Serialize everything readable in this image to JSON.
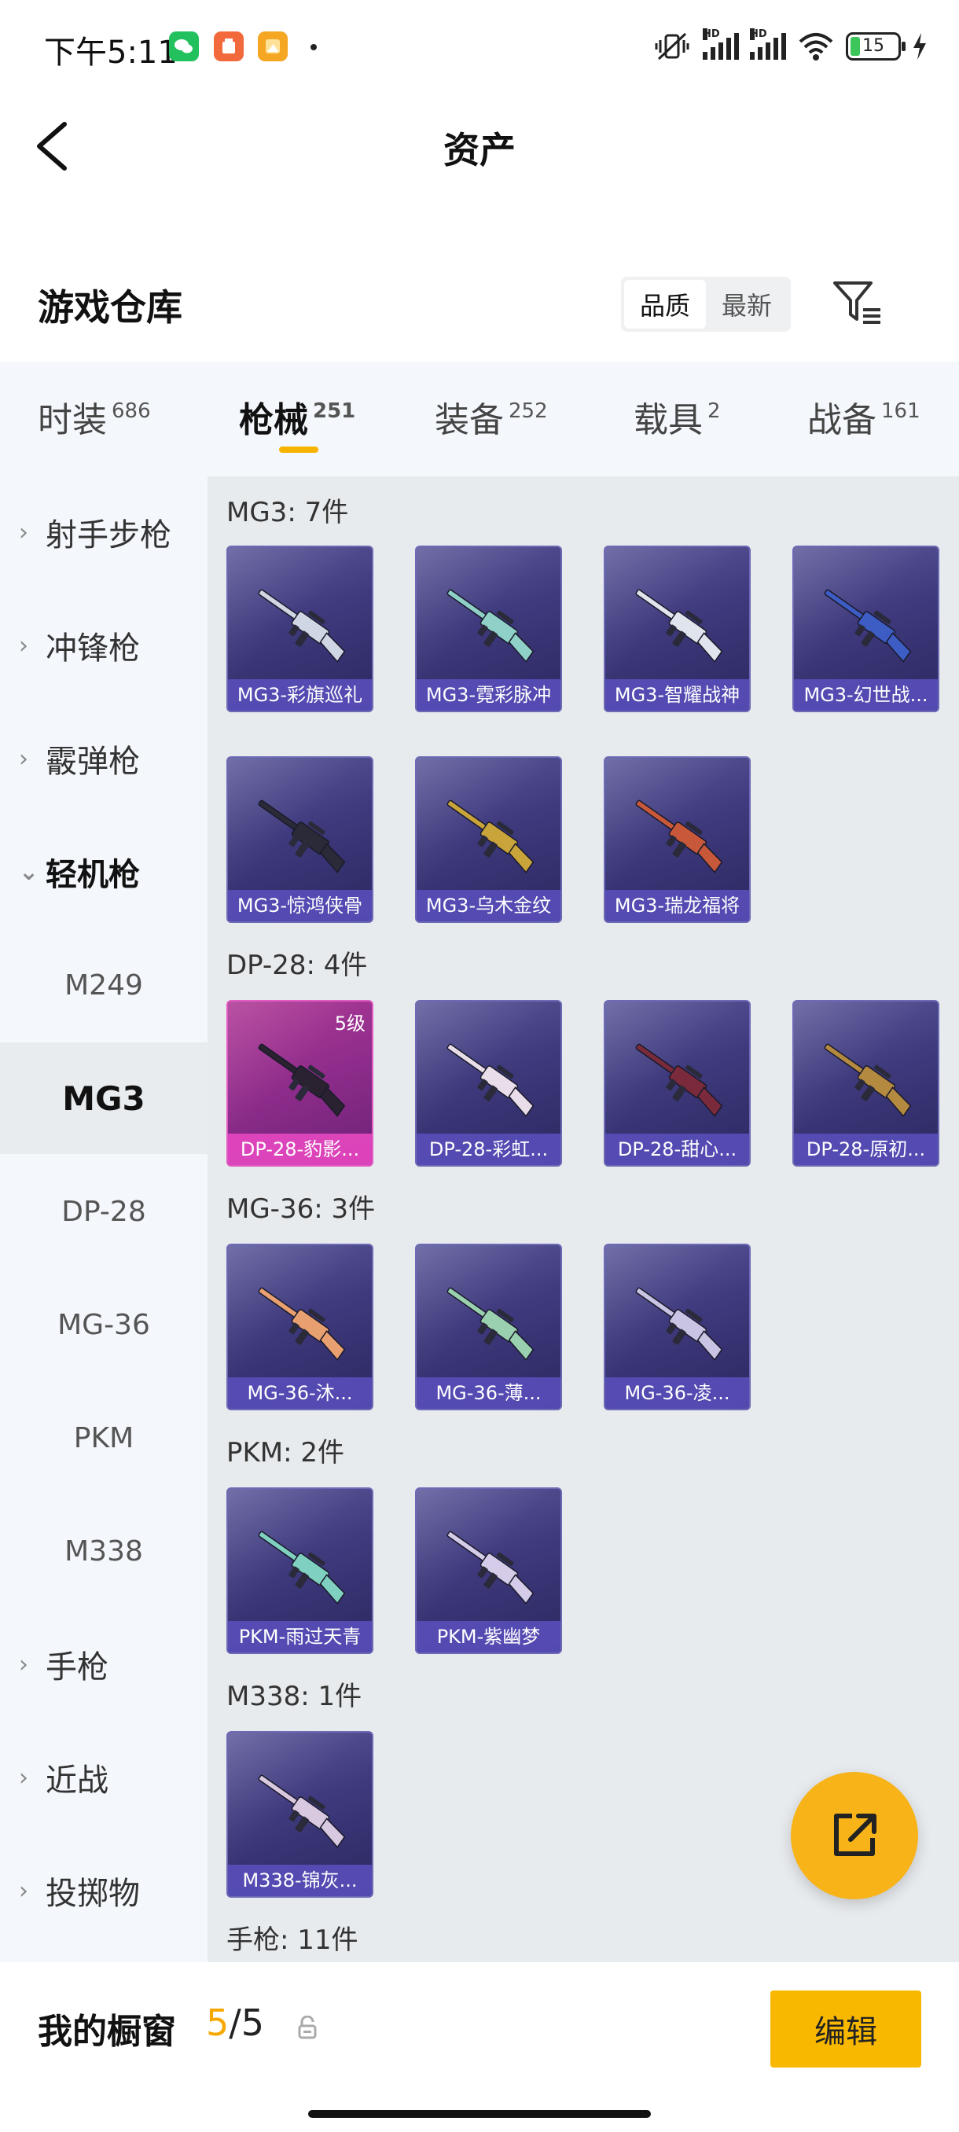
{
  "status_bar": {
    "time": "下午5:11",
    "battery": "15",
    "signal_label_1": "HD",
    "signal_label_2": "HD"
  },
  "header": {
    "title": "资产"
  },
  "warehouse": {
    "title": "游戏仓库",
    "sort_options": [
      "品质",
      "最新"
    ],
    "active_sort": "品质"
  },
  "tabs": [
    {
      "label": "时装",
      "count": "686"
    },
    {
      "label": "枪械",
      "count": "251"
    },
    {
      "label": "装备",
      "count": "252"
    },
    {
      "label": "载具",
      "count": "2"
    },
    {
      "label": "战备",
      "count": "161"
    }
  ],
  "active_tab": "枪械",
  "sidebar": {
    "items": [
      {
        "label": "射手步枪",
        "type": "category"
      },
      {
        "label": "冲锋枪",
        "type": "category"
      },
      {
        "label": "霰弹枪",
        "type": "category"
      },
      {
        "label": "轻机枪",
        "type": "category-open"
      },
      {
        "label": "M249",
        "type": "sub"
      },
      {
        "label": "MG3",
        "type": "sub-active"
      },
      {
        "label": "DP-28",
        "type": "sub"
      },
      {
        "label": "MG-36",
        "type": "sub"
      },
      {
        "label": "PKM",
        "type": "sub"
      },
      {
        "label": "M338",
        "type": "sub"
      },
      {
        "label": "手枪",
        "type": "category"
      },
      {
        "label": "近战",
        "type": "category"
      },
      {
        "label": "投掷物",
        "type": "category"
      }
    ]
  },
  "groups": [
    {
      "title": "MG3: 7件",
      "items": [
        {
          "name": "MG3-彩旗巡礼",
          "color": "#cfd6e4"
        },
        {
          "name": "MG3-霓彩脉冲",
          "color": "#8fd0c8"
        },
        {
          "name": "MG3-智耀战神",
          "color": "#e0e4ec"
        },
        {
          "name": "MG3-幻世战...",
          "color": "#3d5cc4"
        },
        {
          "name": "MG3-惊鸿侠骨",
          "color": "#2a2a38"
        },
        {
          "name": "MG3-乌木金纹",
          "color": "#c9a43a"
        },
        {
          "name": "MG3-瑞龙福将",
          "color": "#c8583a"
        }
      ]
    },
    {
      "title": "DP-28: 4件",
      "items": [
        {
          "name": "DP-28-豹影...",
          "color": "#2a2230",
          "level": "5级",
          "highlight": true
        },
        {
          "name": "DP-28-彩虹...",
          "color": "#e8dde8"
        },
        {
          "name": "DP-28-甜心...",
          "color": "#7a2a3a"
        },
        {
          "name": "DP-28-原初...",
          "color": "#b48a40"
        }
      ]
    },
    {
      "title": "MG-36: 3件",
      "items": [
        {
          "name": "MG-36-沐...",
          "color": "#e8a070"
        },
        {
          "name": "MG-36-薄...",
          "color": "#9ad0b0"
        },
        {
          "name": "MG-36-凌...",
          "color": "#c9c4e4"
        }
      ]
    },
    {
      "title": "PKM: 2件",
      "items": [
        {
          "name": "PKM-雨过天青",
          "color": "#7fd0c0"
        },
        {
          "name": "PKM-紫幽梦",
          "color": "#d4cce8"
        }
      ]
    },
    {
      "title": "M338: 1件",
      "items": [
        {
          "name": "M338-锦灰...",
          "color": "#d8c8e0"
        }
      ]
    },
    {
      "title": "手枪: 11件",
      "items": []
    }
  ],
  "showcase": {
    "label": "我的橱窗",
    "current": "5",
    "separator": "/",
    "total": "5",
    "edit_label": "编辑"
  }
}
